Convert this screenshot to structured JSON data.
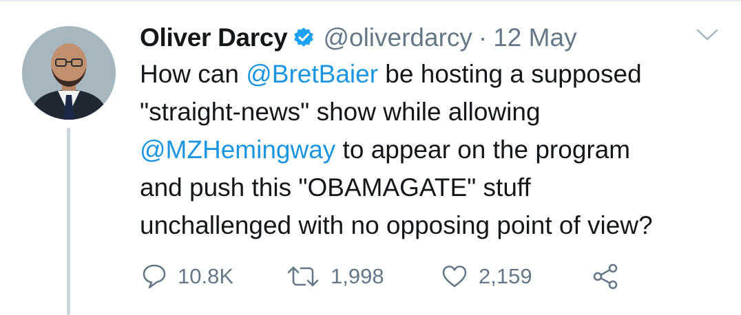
{
  "tweet": {
    "author_name": "Oliver Darcy",
    "handle": "@oliverdarcy",
    "separator": "·",
    "date": "12 May",
    "text_lines": [
      [
        {
          "text": "How can ",
          "mention": false
        },
        {
          "text": "@BretBaier",
          "mention": true
        },
        {
          "text": " be hosting a supposed",
          "mention": false
        }
      ],
      [
        {
          "text": "\"straight-news\" show while allowing",
          "mention": false
        }
      ],
      [
        {
          "text": "@MZHemingway",
          "mention": true
        },
        {
          "text": " to appear on the program",
          "mention": false
        }
      ],
      [
        {
          "text": "and push this \"OBAMAGATE\" stuff",
          "mention": false
        }
      ],
      [
        {
          "text": "unchallenged with no opposing point of view?",
          "mention": false
        }
      ]
    ]
  },
  "actions": {
    "reply_count": "10.8K",
    "retweet_count": "1,998",
    "like_count": "2,159"
  },
  "icons": {
    "verified": "verified-badge-icon",
    "caret": "chevron-down-icon",
    "reply": "reply-icon",
    "retweet": "retweet-icon",
    "like": "heart-icon",
    "share": "share-icon"
  },
  "colors": {
    "mention": "#1b95e0",
    "verified": "#1da1f2",
    "muted": "#657786",
    "text": "#14171a"
  }
}
